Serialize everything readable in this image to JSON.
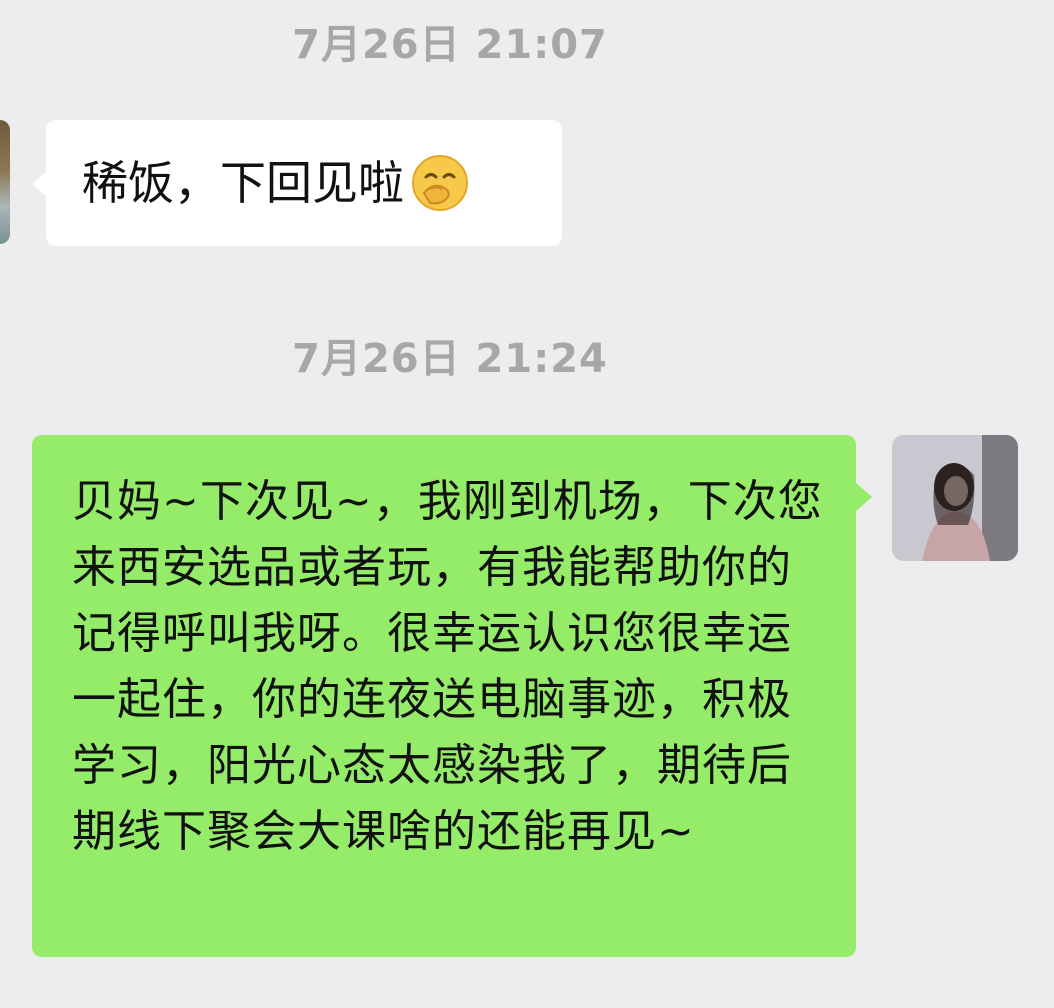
{
  "chat": {
    "timestamp_1": "7月26日 21:07",
    "incoming_message": "稀饭，下回见啦",
    "incoming_emoji": "smirk-face-emoji",
    "timestamp_2": "7月26日 21:24",
    "outgoing_message": "贝妈~下次见~，我刚到机场，下次您来西安选品或者玩，有我能帮助你的记得呼叫我呀。很幸运认识您很幸运一起住，你的连夜送电脑事迹，积极学习，阳光心态太感染我了，期待后期线下聚会大课啥的还能再见~"
  },
  "colors": {
    "background": "#ededed",
    "incoming_bubble": "#ffffff",
    "outgoing_bubble": "#95ec69",
    "timestamp": "#a7a7a7"
  }
}
